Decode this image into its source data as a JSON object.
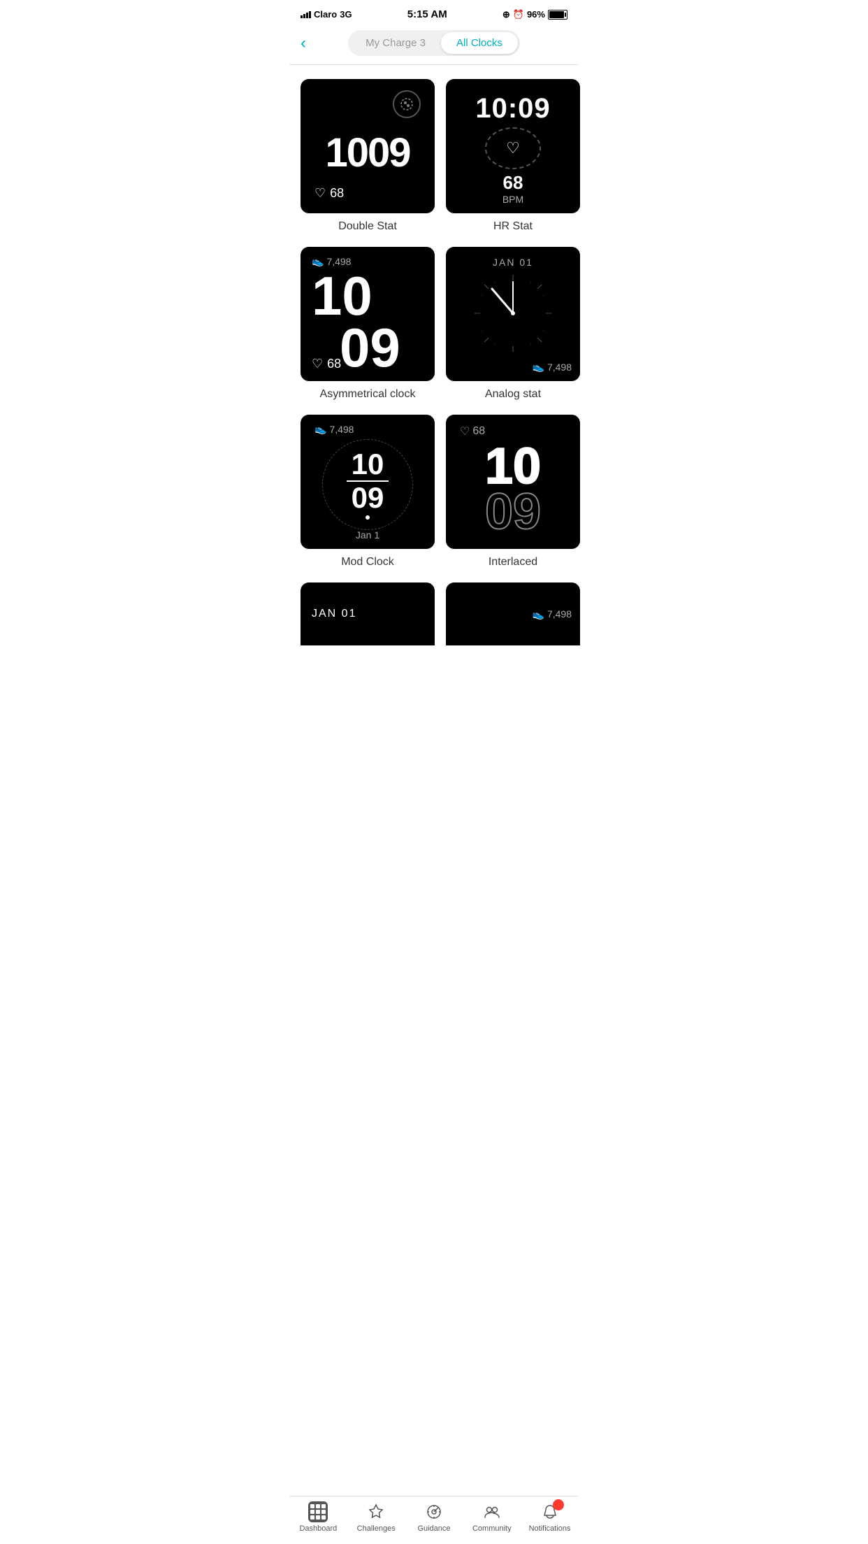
{
  "status": {
    "carrier": "Claro",
    "network": "3G",
    "time": "5:15 AM",
    "battery": "96%"
  },
  "header": {
    "tab_device": "My Charge 3",
    "tab_all": "All Clocks",
    "active_tab": "all"
  },
  "clocks": [
    {
      "id": "double-stat",
      "label": "Double Stat",
      "type": "double-stat",
      "time": "1009",
      "hr": "68"
    },
    {
      "id": "hr-stat",
      "label": "HR Stat",
      "type": "hr-stat",
      "time": "10:09",
      "hr": "68",
      "bpm": "BPM"
    },
    {
      "id": "asymmetrical",
      "label": "Asymmetrical clock",
      "type": "asym",
      "steps": "7,498",
      "hour": "10",
      "minute": "09",
      "hr": "68"
    },
    {
      "id": "analog-stat",
      "label": "Analog stat",
      "type": "analog",
      "date": "JAN 01",
      "steps": "7,498"
    },
    {
      "id": "mod-clock",
      "label": "Mod Clock",
      "type": "mod",
      "steps": "7,498",
      "hour": "10",
      "minute": "09",
      "date": "Jan 1"
    },
    {
      "id": "interlaced",
      "label": "Interlaced",
      "type": "interlaced",
      "hr": "68",
      "hour": "10",
      "minute": "09"
    }
  ],
  "partial_clocks": [
    {
      "id": "partial-1",
      "type": "date",
      "text": "JAN 01"
    },
    {
      "id": "partial-2",
      "type": "steps",
      "steps": "7,498"
    }
  ],
  "bottom_nav": {
    "items": [
      {
        "id": "dashboard",
        "label": "Dashboard",
        "active": true
      },
      {
        "id": "challenges",
        "label": "Challenges",
        "active": false
      },
      {
        "id": "guidance",
        "label": "Guidance",
        "active": false
      },
      {
        "id": "community",
        "label": "Community",
        "active": false
      },
      {
        "id": "notifications",
        "label": "Notifications",
        "active": false
      }
    ]
  }
}
